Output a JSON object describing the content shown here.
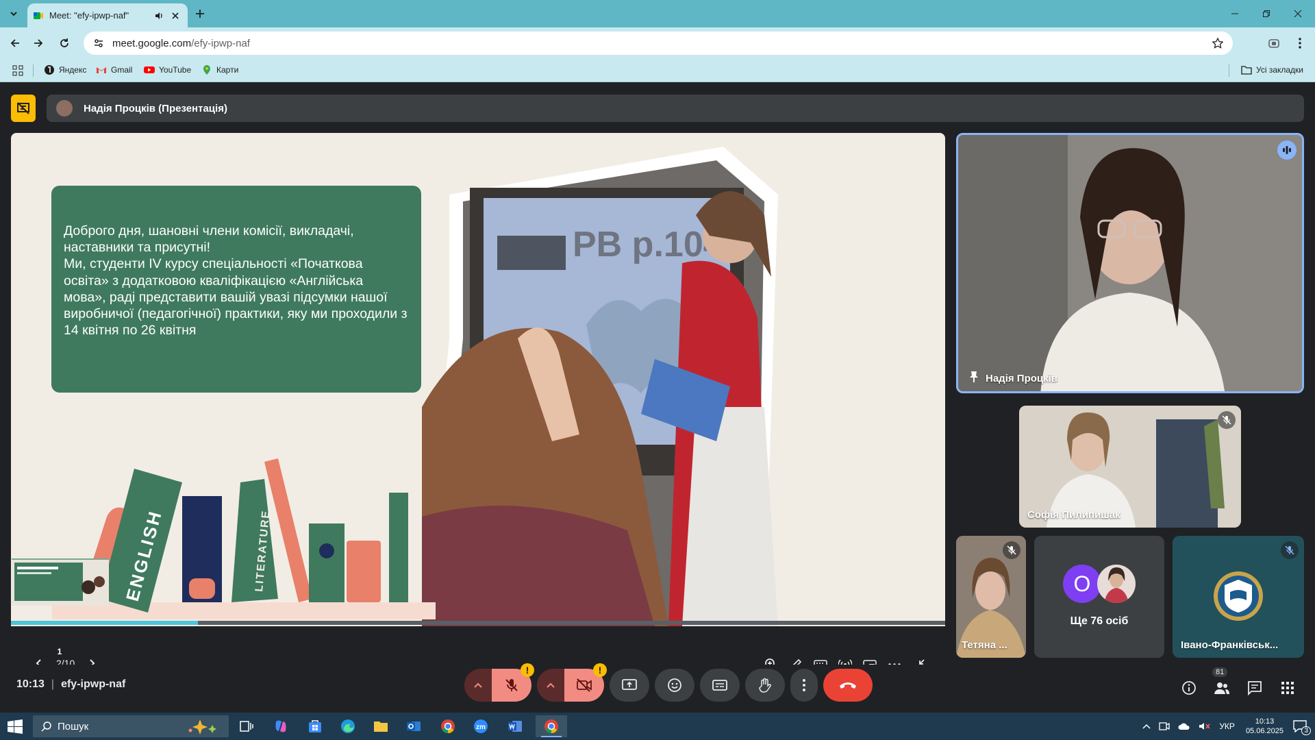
{
  "browser": {
    "tab": {
      "title": "Meet: \"efy-ipwp-naf\""
    },
    "url": {
      "domain": "meet.google.com",
      "path": "/efy-ipwp-naf"
    },
    "bookmarks": [
      {
        "label": "Яндекс",
        "icon": "yandex-icon"
      },
      {
        "label": "Gmail",
        "icon": "gmail-icon"
      },
      {
        "label": "YouTube",
        "icon": "youtube-icon"
      },
      {
        "label": "Карти",
        "icon": "maps-icon"
      }
    ],
    "all_bookmarks": "Усі закладки"
  },
  "meet": {
    "presenter_label": "Надія Процків (Презентація)",
    "slide": {
      "text": "Доброго дня, шановні члени комісії, викладачі, наставники та присутні!\nМи, студенти IV курсу спеціальності «Початкова освіта» з додатковою кваліфікацією «Англійська мова», раді представити вашій увазі підсумки нашої виробничої (педагогічної) практики, яку ми проходили з 14 квітня по 26 квітня",
      "board_text": "PB p.104",
      "book_spines": [
        "ENGLISH",
        "LITERATURE"
      ],
      "page_indicator": "2/10",
      "progress": 0.2,
      "pin_number": "1"
    },
    "participants": [
      {
        "name": "Надія Процків",
        "pinned": true
      },
      {
        "name": "Софія Пилипишак",
        "muted": true
      },
      {
        "name": "Тетяна ...",
        "muted": true
      },
      {
        "name": "Ще 76 осіб",
        "avatar_letter": "О"
      },
      {
        "name": "Івано-Франківськ...",
        "muted": true
      }
    ],
    "time": "10:13",
    "meeting_code": "efy-ipwp-naf",
    "people_count": "81",
    "colors": {
      "accent": "#8ab4f8",
      "end_call": "#ea4335",
      "warning": "#fbbc04",
      "slide_green": "#3f7a5e"
    }
  },
  "taskbar": {
    "search_placeholder": "Пошук",
    "lang": "УКР",
    "time": "10:13",
    "date": "05.06.2025",
    "notifications": "3"
  }
}
